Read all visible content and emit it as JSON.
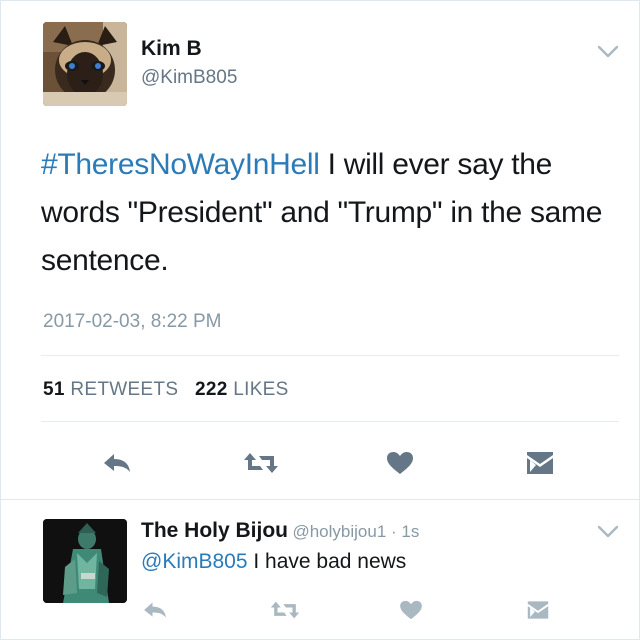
{
  "tweet": {
    "author_name": "Kim B",
    "author_handle": "@KimB805",
    "hashtag": "#TheresNoWayInHell",
    "text": " I will ever say the words \"President\" and \"Trump\" in the same sentence.",
    "timestamp": "2017-02-03, 8:22 PM",
    "retweet_count": "51",
    "retweet_label": "RETWEETS",
    "like_count": "222",
    "like_label": "LIKES",
    "avatar_icon": "cat-avatar",
    "actions": [
      "reply-icon",
      "retweet-icon",
      "like-icon",
      "direct-message-icon"
    ]
  },
  "reply": {
    "author_name": "The Holy Bijou",
    "meta": "@holybijou1 · 1s",
    "mention": "@KimB805",
    "text": " I have bad news",
    "avatar_icon": "statue-avatar",
    "actions": [
      "reply-icon",
      "retweet-icon",
      "like-icon",
      "direct-message-icon"
    ]
  },
  "colors": {
    "link": "#2b7bb9",
    "secondary_text": "#657786",
    "action_dark": "#657786",
    "action_light": "#aab8c2"
  }
}
